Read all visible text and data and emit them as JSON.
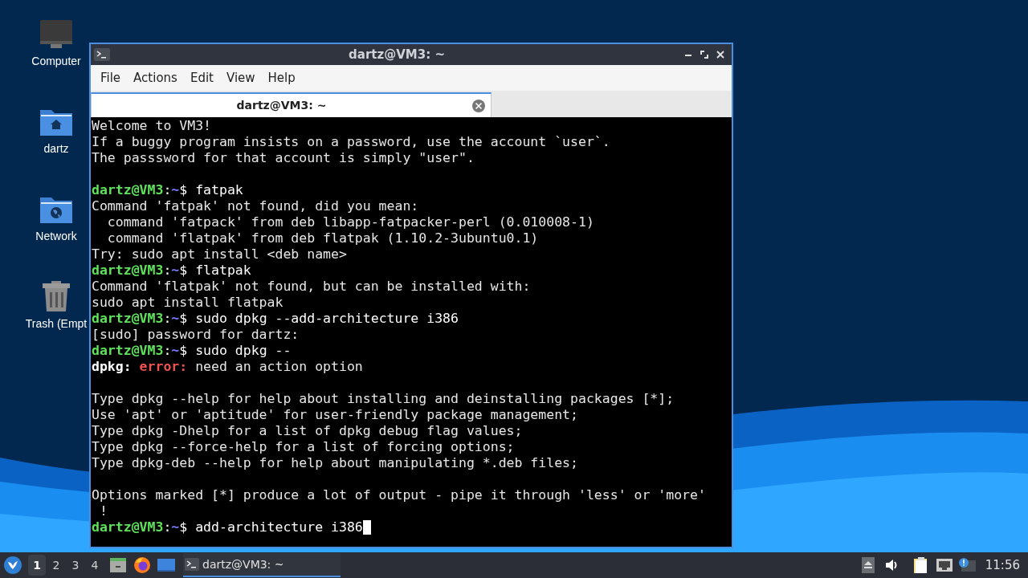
{
  "desktop_icons": [
    {
      "label": "Computer",
      "kind": "computer"
    },
    {
      "label": "dartz",
      "kind": "home"
    },
    {
      "label": "Network",
      "kind": "network"
    },
    {
      "label": "Trash (Empt",
      "kind": "trash"
    }
  ],
  "window": {
    "title": "dartz@VM3: ~",
    "menu": [
      "File",
      "Actions",
      "Edit",
      "View",
      "Help"
    ],
    "tabs": [
      {
        "label": "dartz@VM3: ~",
        "selected": true
      }
    ],
    "terminal": {
      "cursor": true,
      "lines": [
        {
          "kind": "text",
          "text": "Welcome to VM3!"
        },
        {
          "kind": "text",
          "text": "If a buggy program insists on a password, use the account `user`."
        },
        {
          "kind": "text",
          "text": "The passsword for that account is simply \"user\"."
        },
        {
          "kind": "blank"
        },
        {
          "kind": "prompt",
          "user": "dartz@VM3",
          "sep": ":",
          "path": "~",
          "sigil": "$",
          "command": "fatpak"
        },
        {
          "kind": "text",
          "text": "Command 'fatpak' not found, did you mean:"
        },
        {
          "kind": "text",
          "text": "  command 'fatpack' from deb libapp-fatpacker-perl (0.010008-1)"
        },
        {
          "kind": "text",
          "text": "  command 'flatpak' from deb flatpak (1.10.2-3ubuntu0.1)"
        },
        {
          "kind": "text",
          "text": "Try: sudo apt install <deb name>"
        },
        {
          "kind": "prompt",
          "user": "dartz@VM3",
          "sep": ":",
          "path": "~",
          "sigil": "$",
          "command": "flatpak"
        },
        {
          "kind": "text",
          "text": "Command 'flatpak' not found, but can be installed with:"
        },
        {
          "kind": "text",
          "text": "sudo apt install flatpak"
        },
        {
          "kind": "prompt",
          "user": "dartz@VM3",
          "sep": ":",
          "path": "~",
          "sigil": "$",
          "command": "sudo dpkg --add-architecture i386"
        },
        {
          "kind": "text",
          "text": "[sudo] password for dartz:"
        },
        {
          "kind": "prompt",
          "user": "dartz@VM3",
          "sep": ":",
          "path": "~",
          "sigil": "$",
          "command": "sudo dpkg --"
        },
        {
          "kind": "error",
          "program": "dpkg:",
          "label": "error:",
          "message": "need an action option"
        },
        {
          "kind": "blank"
        },
        {
          "kind": "text",
          "text": "Type dpkg --help for help about installing and deinstalling packages [*];"
        },
        {
          "kind": "text",
          "text": "Use 'apt' or 'aptitude' for user-friendly package management;"
        },
        {
          "kind": "text",
          "text": "Type dpkg -Dhelp for a list of dpkg debug flag values;"
        },
        {
          "kind": "text",
          "text": "Type dpkg --force-help for a list of forcing options;"
        },
        {
          "kind": "text",
          "text": "Type dpkg-deb --help for help about manipulating *.deb files;"
        },
        {
          "kind": "blank"
        },
        {
          "kind": "text",
          "text": "Options marked [*] produce a lot of output - pipe it through 'less' or 'more'"
        },
        {
          "kind": "text",
          "text": " !"
        },
        {
          "kind": "prompt",
          "user": "dartz@VM3",
          "sep": ":",
          "path": "~",
          "sigil": "$",
          "command": "add-architecture i386"
        }
      ]
    }
  },
  "taskbar": {
    "workspaces": [
      {
        "label": "1",
        "selected": true
      },
      {
        "label": "2",
        "selected": false
      },
      {
        "label": "3",
        "selected": false
      },
      {
        "label": "4",
        "selected": false
      }
    ],
    "tasks": [
      {
        "label": "dartz@VM3: ~",
        "selected": true
      }
    ],
    "clock": "11:56"
  }
}
